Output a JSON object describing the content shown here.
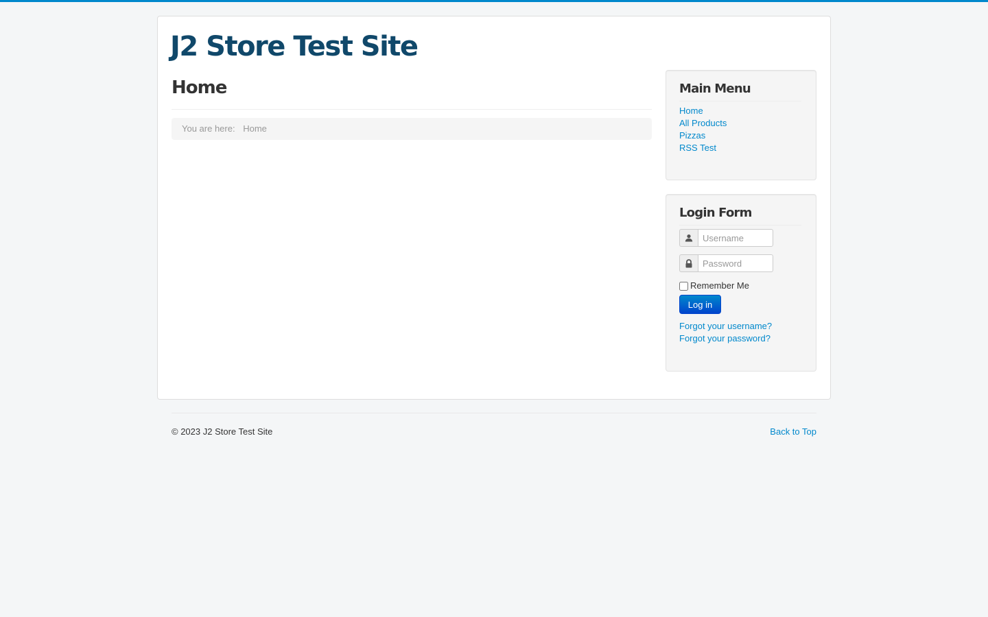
{
  "site": {
    "title": "J2 Store Test Site",
    "accent_color": "#0088cc",
    "title_color": "#10486a"
  },
  "main": {
    "heading": "Home",
    "breadcrumb": {
      "prefix": "You are here:",
      "current": "Home"
    }
  },
  "main_menu": {
    "title": "Main Menu",
    "items": [
      {
        "label": "Home"
      },
      {
        "label": "All Products"
      },
      {
        "label": "Pizzas"
      },
      {
        "label": "RSS Test"
      }
    ]
  },
  "login_form": {
    "title": "Login Form",
    "username_placeholder": "Username",
    "password_placeholder": "Password",
    "username_icon": "user-icon",
    "password_icon": "lock-icon",
    "remember_label": "Remember Me",
    "submit_label": "Log in",
    "forgot_username": "Forgot your username?",
    "forgot_password": "Forgot your password?"
  },
  "footer": {
    "copyright": "© 2023 J2 Store Test Site",
    "back_to_top": "Back to Top"
  }
}
